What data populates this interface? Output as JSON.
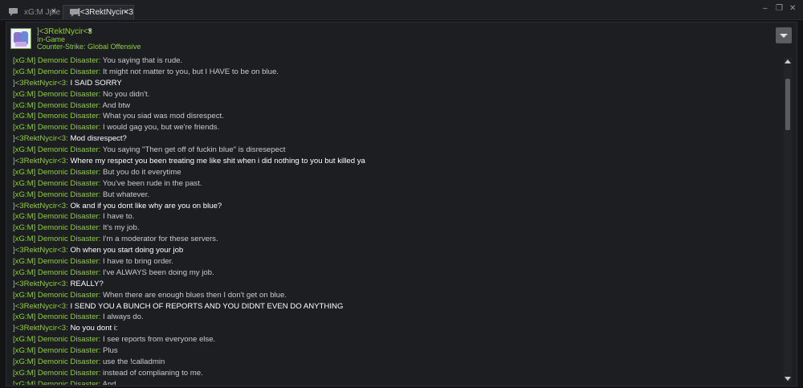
{
  "tabs": [
    {
      "label": "xG:M Jpie",
      "close": "×",
      "active": false
    },
    {
      "label": "]<3RektNycir<3",
      "close": "×",
      "active": true
    }
  ],
  "window_controls": {
    "minimize": "–",
    "maximize": "❐",
    "close": "✕"
  },
  "contact": {
    "name": "]<3RektNycir<3",
    "status": "In-Game",
    "game": "Counter-Strike: Global Offensive"
  },
  "messages": [
    {
      "sender": "[xG:M] Demonic Disaster",
      "self": false,
      "text": "You saying that is rude."
    },
    {
      "sender": "[xG:M] Demonic Disaster",
      "self": false,
      "text": "It might not matter to you, but I HAVE to be on blue."
    },
    {
      "sender": "]<3RektNycir<3",
      "self": true,
      "text": "I SAID SORRY"
    },
    {
      "sender": "[xG:M] Demonic Disaster",
      "self": false,
      "text": "No you didn't."
    },
    {
      "sender": "[xG:M] Demonic Disaster",
      "self": false,
      "text": "And btw"
    },
    {
      "sender": "[xG:M] Demonic Disaster",
      "self": false,
      "text": "What you siad was mod disrespect."
    },
    {
      "sender": "[xG:M] Demonic Disaster",
      "self": false,
      "text": "I would gag you, but we're friends."
    },
    {
      "sender": "]<3RektNycir<3",
      "self": true,
      "text": "Mod disrespect?"
    },
    {
      "sender": "[xG:M] Demonic Disaster",
      "self": false,
      "text": "You saying \"Then get off of fuckin blue\" is disresepect"
    },
    {
      "sender": "]<3RektNycir<3",
      "self": true,
      "text": "Where my respect you been treating me like shit when i did nothing to you but killed ya"
    },
    {
      "sender": "[xG:M] Demonic Disaster",
      "self": false,
      "text": "But you do it everytime"
    },
    {
      "sender": "[xG:M] Demonic Disaster",
      "self": false,
      "text": "You've been rude in the past."
    },
    {
      "sender": "[xG:M] Demonic Disaster",
      "self": false,
      "text": "But whatever."
    },
    {
      "sender": "]<3RektNycir<3",
      "self": true,
      "text": "Ok and if you dont like why are you on blue?"
    },
    {
      "sender": "[xG:M] Demonic Disaster",
      "self": false,
      "text": "I have to."
    },
    {
      "sender": "[xG:M] Demonic Disaster",
      "self": false,
      "text": "It's my job."
    },
    {
      "sender": "[xG:M] Demonic Disaster",
      "self": false,
      "text": "I'm a moderator for these servers."
    },
    {
      "sender": "]<3RektNycir<3",
      "self": true,
      "text": "Oh when you start doing your job"
    },
    {
      "sender": "[xG:M] Demonic Disaster",
      "self": false,
      "text": "I have to bring order."
    },
    {
      "sender": "[xG:M] Demonic Disaster",
      "self": false,
      "text": "I've ALWAYS been doing my job."
    },
    {
      "sender": "]<3RektNycir<3",
      "self": true,
      "text": "REALLY?"
    },
    {
      "sender": "[xG:M] Demonic Disaster",
      "self": false,
      "text": "When there are enough blues then I don't get on blue."
    },
    {
      "sender": "]<3RektNycir<3",
      "self": true,
      "text": "I SEND YOU A BUNCH OF REPORTS AND YOU DIDNT EVEN DO ANYTHING"
    },
    {
      "sender": "[xG:M] Demonic Disaster",
      "self": false,
      "text": "I always do."
    },
    {
      "sender": "]<3RektNycir<3",
      "self": true,
      "text": "No you dont i:"
    },
    {
      "sender": "[xG:M] Demonic Disaster",
      "self": false,
      "text": "I see reports from everyone else."
    },
    {
      "sender": "[xG:M] Demonic Disaster",
      "self": false,
      "text": "Plus"
    },
    {
      "sender": "[xG:M] Demonic Disaster",
      "self": false,
      "text": "use the !calladmin"
    },
    {
      "sender": "[xG:M] Demonic Disaster",
      "self": false,
      "text": "instead of complianing to me."
    },
    {
      "sender": "[xG:M] Demonic Disaster",
      "self": false,
      "text": "And"
    }
  ]
}
